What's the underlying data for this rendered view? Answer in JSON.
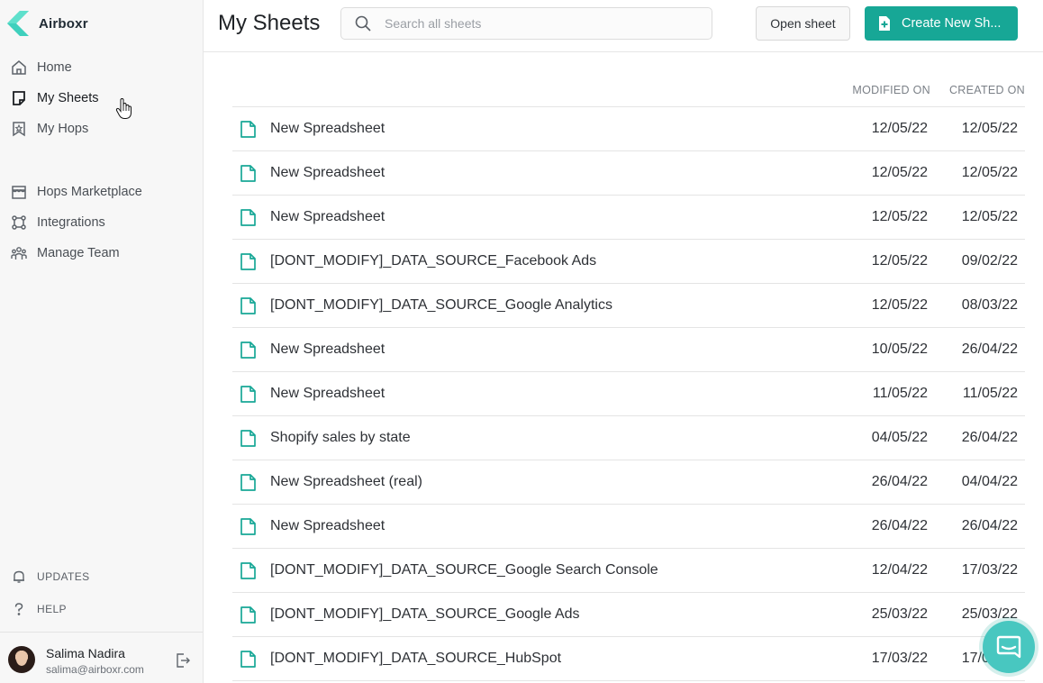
{
  "app": {
    "name": "Airboxr",
    "brand_color": "#17a796"
  },
  "sidebar": {
    "nav": [
      {
        "id": "home",
        "label": "Home",
        "icon": "home-icon"
      },
      {
        "id": "my-sheets",
        "label": "My Sheets",
        "icon": "sheet-icon",
        "active": true
      },
      {
        "id": "my-hops",
        "label": "My Hops",
        "icon": "bookmark-icon"
      },
      {
        "id": "hops-marketplace",
        "label": "Hops Marketplace",
        "icon": "store-icon"
      },
      {
        "id": "integrations",
        "label": "Integrations",
        "icon": "integrations-icon"
      },
      {
        "id": "manage-team",
        "label": "Manage Team",
        "icon": "team-icon"
      }
    ],
    "footer_links": [
      {
        "id": "updates",
        "label": "UPDATES",
        "icon": "bell-icon"
      },
      {
        "id": "help",
        "label": "HELP",
        "icon": "question-icon"
      }
    ],
    "user": {
      "name": "Salima Nadira",
      "email": "salima@airboxr.com"
    }
  },
  "header": {
    "title": "My Sheets",
    "search_placeholder": "Search all sheets",
    "open_sheet_label": "Open sheet",
    "create_label": "Create New Sh..."
  },
  "table": {
    "columns": {
      "modified": "MODIFIED ON",
      "created": "CREATED ON"
    },
    "rows": [
      {
        "name": "New Spreadsheet",
        "modified": "12/05/22",
        "created": "12/05/22"
      },
      {
        "name": "New Spreadsheet",
        "modified": "12/05/22",
        "created": "12/05/22"
      },
      {
        "name": "New Spreadsheet",
        "modified": "12/05/22",
        "created": "12/05/22"
      },
      {
        "name": "[DONT_MODIFY]_DATA_SOURCE_Facebook Ads",
        "modified": "12/05/22",
        "created": "09/02/22"
      },
      {
        "name": "[DONT_MODIFY]_DATA_SOURCE_Google Analytics",
        "modified": "12/05/22",
        "created": "08/03/22"
      },
      {
        "name": "New Spreadsheet",
        "modified": "10/05/22",
        "created": "26/04/22"
      },
      {
        "name": "New Spreadsheet",
        "modified": "11/05/22",
        "created": "11/05/22"
      },
      {
        "name": "Shopify sales by state",
        "modified": "04/05/22",
        "created": "26/04/22"
      },
      {
        "name": "New Spreadsheet (real)",
        "modified": "26/04/22",
        "created": "04/04/22"
      },
      {
        "name": "New Spreadsheet",
        "modified": "26/04/22",
        "created": "26/04/22"
      },
      {
        "name": "[DONT_MODIFY]_DATA_SOURCE_Google Search Console",
        "modified": "12/04/22",
        "created": "17/03/22"
      },
      {
        "name": "[DONT_MODIFY]_DATA_SOURCE_Google Ads",
        "modified": "25/03/22",
        "created": "25/03/22"
      },
      {
        "name": "[DONT_MODIFY]_DATA_SOURCE_HubSpot",
        "modified": "17/03/22",
        "created": "17/03/22"
      }
    ]
  }
}
